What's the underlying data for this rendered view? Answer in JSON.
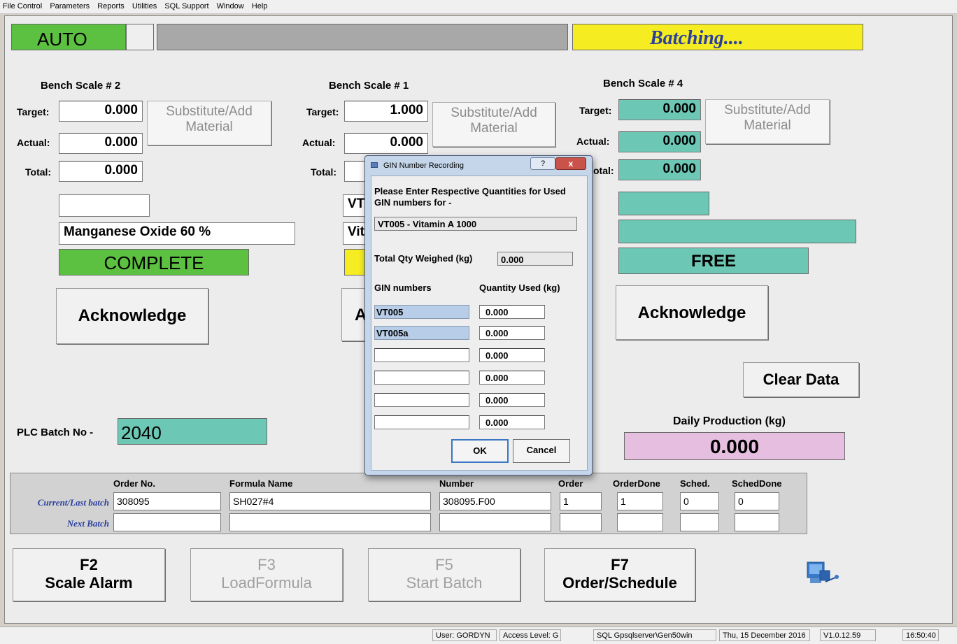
{
  "menu": [
    "File Control",
    "Parameters",
    "Reports",
    "Utilities",
    "SQL Support",
    "Window",
    "Help"
  ],
  "header": {
    "mode": "AUTO",
    "status": "Batching....",
    "colors": {
      "mode": "#5cc041",
      "status": "#f5ec22",
      "bar": "#a8a8a8"
    }
  },
  "scales": [
    {
      "title": "Bench Scale # 2",
      "target_label": "Target:",
      "actual_label": "Actual:",
      "total_label": "Total:",
      "target": "0.000",
      "actual": "0.000",
      "total": "0.000",
      "substitute": "Substitute/Add\nMaterial",
      "code": "",
      "material": "Manganese Oxide 60 %",
      "state": "COMPLETE",
      "acknowledge": "Acknowledge"
    },
    {
      "title": "Bench Scale # 1",
      "target_label": "Target:",
      "actual_label": "Actual:",
      "total_label": "Total:",
      "target": "1.000",
      "actual": "0.000",
      "total": "",
      "substitute": "Substitute/Add\nMaterial",
      "code": "VT",
      "material": "Vit",
      "state": "",
      "acknowledge": "A"
    },
    {
      "title": "Bench Scale # 4",
      "target_label": "Target:",
      "actual_label": "Actual:",
      "total_label": "otal:",
      "target": "0.000",
      "actual": "0.000",
      "total": "0.000",
      "substitute": "Substitute/Add\nMaterial",
      "code": "",
      "material": "",
      "state": "FREE",
      "acknowledge": "Acknowledge"
    }
  ],
  "clear_data": "Clear Data",
  "plc": {
    "label": "PLC Batch No -",
    "value": "2040"
  },
  "daily": {
    "label": "Daily Production (kg)",
    "value": "0.000"
  },
  "orders": {
    "headers": [
      "Order No.",
      "Formula Name",
      "Number",
      "Order",
      "OrderDone",
      "Sched.",
      "SchedDone"
    ],
    "current_label": "Current/Last batch",
    "next_label": "Next Batch",
    "current": [
      "308095",
      "SH027#4",
      "308095.F00",
      "1",
      "1",
      "0",
      "0"
    ],
    "next": [
      "",
      "",
      "",
      "",
      "",
      "",
      ""
    ]
  },
  "fkeys": [
    {
      "key": "F2",
      "label": "Scale Alarm",
      "enabled": true
    },
    {
      "key": "F3",
      "label": "LoadFormula",
      "enabled": false
    },
    {
      "key": "F5",
      "label": "Start Batch",
      "enabled": false
    },
    {
      "key": "F7",
      "label": "Order/Schedule",
      "enabled": true
    }
  ],
  "statusbar": {
    "user": "User: GORDYN",
    "access": "Access Level: G",
    "sql": "SQL  Gpsqlserver\\Gen50win",
    "date": "Thu, 15 December 2016",
    "version": "V1.0.12.59",
    "time": "16:50:40"
  },
  "dialog": {
    "title": "GIN Number Recording",
    "help": "?",
    "close": "x",
    "prompt": "Please Enter Respective Quantities for Used GIN numbers for -",
    "material": "VT005 - Vitamin A 1000",
    "total_label": "Total Qty Weighed (kg)",
    "total": "0.000",
    "col_gin": "GIN numbers",
    "col_qty": "Quantity Used (kg)",
    "rows": [
      {
        "gin": "VT005",
        "qty": "0.000"
      },
      {
        "gin": "VT005a",
        "qty": "0.000"
      },
      {
        "gin": "",
        "qty": "0.000"
      },
      {
        "gin": "",
        "qty": "0.000"
      },
      {
        "gin": "",
        "qty": "0.000"
      },
      {
        "gin": "",
        "qty": "0.000"
      }
    ],
    "ok": "OK",
    "cancel": "Cancel"
  }
}
